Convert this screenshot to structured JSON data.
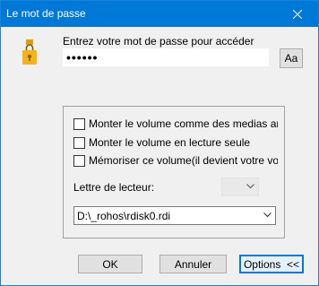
{
  "window": {
    "title": "Le mot de passe"
  },
  "prompt": {
    "label": "Entrez votre mot de passe pour accéder",
    "password_value": "••••••",
    "toggle_label": "Aa"
  },
  "options": {
    "mount_removable_label": "Monter le volume comme des medias amovib",
    "mount_readonly_label": "Monter le volume en lecture seule",
    "remember_volume_label": "Mémoriser ce volume(il devient votre volume",
    "drive_letter_label": "Lettre de lecteur:",
    "drive_letter_value": "",
    "path_value": "D:\\_rohos\\rdisk0.rdi"
  },
  "buttons": {
    "ok": "OK",
    "cancel": "Annuler",
    "options": "Options  <<"
  },
  "colors": {
    "titlebar": "#0078d7",
    "window_bg": "#f0f0f0",
    "lock_icon": "#f2b418"
  },
  "icons": {
    "app": "usb-lock-icon",
    "close": "close-icon",
    "dropdown": "chevron-down-icon"
  }
}
